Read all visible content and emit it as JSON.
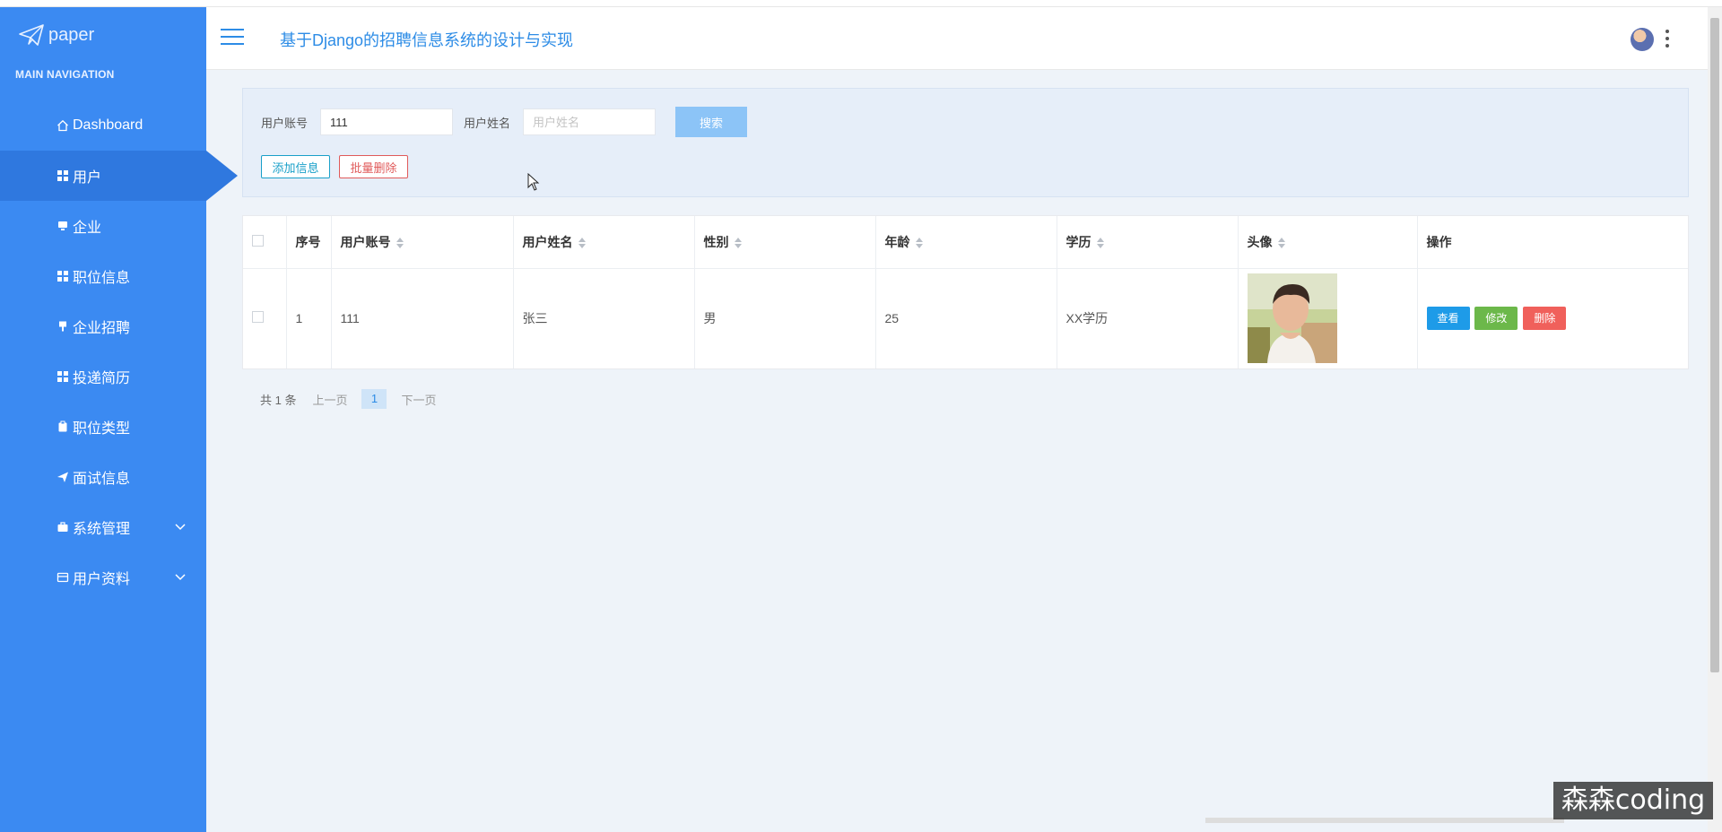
{
  "app": {
    "logo_text": "paper",
    "title": "基于Django的招聘信息系统的设计与实现"
  },
  "sidebar": {
    "header": "MAIN NAVIGATION",
    "items": [
      {
        "label": "Dashboard",
        "icon": "home-icon",
        "active": false
      },
      {
        "label": "用户",
        "icon": "grid-icon",
        "active": true
      },
      {
        "label": "企业",
        "icon": "monitor-icon",
        "active": false
      },
      {
        "label": "职位信息",
        "icon": "grid-icon",
        "active": false
      },
      {
        "label": "企业招聘",
        "icon": "flag-icon",
        "active": false
      },
      {
        "label": "投递简历",
        "icon": "grid-icon",
        "active": false
      },
      {
        "label": "职位类型",
        "icon": "clipboard-icon",
        "active": false
      },
      {
        "label": "面试信息",
        "icon": "send-icon",
        "active": false
      },
      {
        "label": "系统管理",
        "icon": "briefcase-icon",
        "active": false,
        "expandable": true
      },
      {
        "label": "用户资料",
        "icon": "card-icon",
        "active": false,
        "expandable": true
      }
    ]
  },
  "search": {
    "account_label": "用户账号",
    "account_value": "111",
    "name_label": "用户姓名",
    "name_placeholder": "用户姓名",
    "search_button": "搜索",
    "add_button": "添加信息",
    "batch_delete_button": "批量删除"
  },
  "table": {
    "columns": [
      "序号",
      "用户账号",
      "用户姓名",
      "性别",
      "年龄",
      "学历",
      "头像",
      "操作"
    ],
    "rows": [
      {
        "index": "1",
        "account": "111",
        "name": "张三",
        "gender": "男",
        "age": "25",
        "education": "XX学历"
      }
    ],
    "actions": {
      "view": "查看",
      "edit": "修改",
      "delete": "删除"
    }
  },
  "pagination": {
    "total": "共 1 条",
    "prev": "上一页",
    "current": "1",
    "next": "下一页"
  },
  "watermark": "森森coding",
  "colors": {
    "sidebar": "#3b8af2",
    "sidebar_active": "#2f78df",
    "title": "#2d8ce6",
    "view_button": "#1e9be8",
    "edit_button": "#6cb84a",
    "delete_button": "#f0605b"
  }
}
